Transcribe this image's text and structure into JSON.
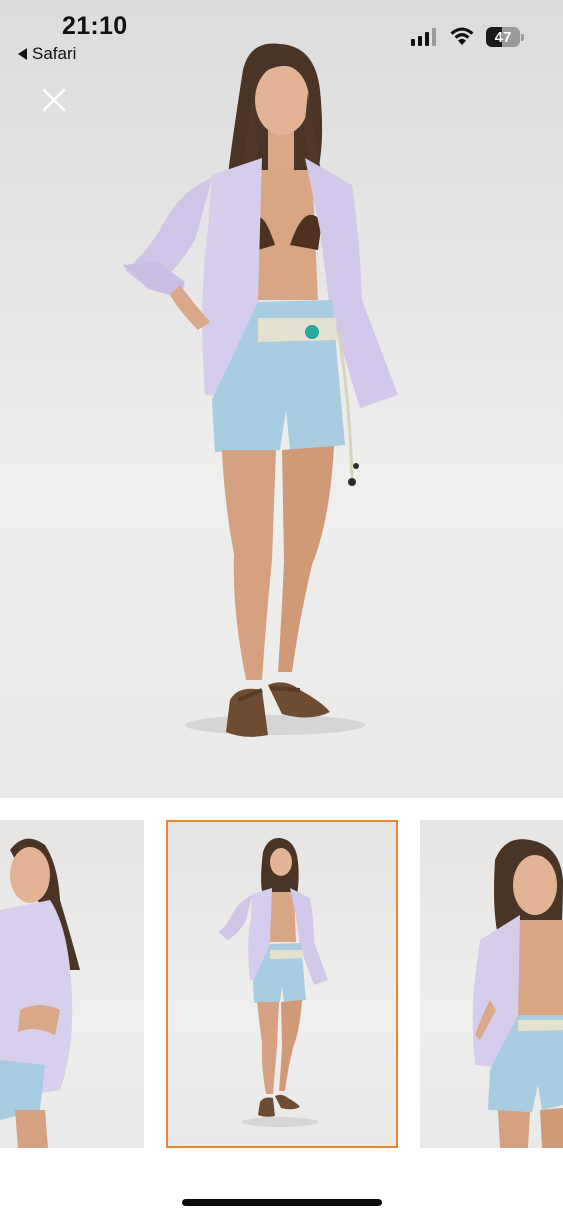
{
  "status_bar": {
    "time": "21:10",
    "back_label": "Safari",
    "battery_level": "47",
    "signal_bars": 3,
    "icons": [
      "signal-icon",
      "wifi-icon",
      "battery-icon"
    ]
  },
  "viewer": {
    "close_icon": "close-icon",
    "selected_thumbnail_index": 1,
    "accent_color": "#e48531",
    "thumbnails": [
      {
        "view": "side"
      },
      {
        "view": "full-front"
      },
      {
        "view": "close-front"
      }
    ]
  }
}
